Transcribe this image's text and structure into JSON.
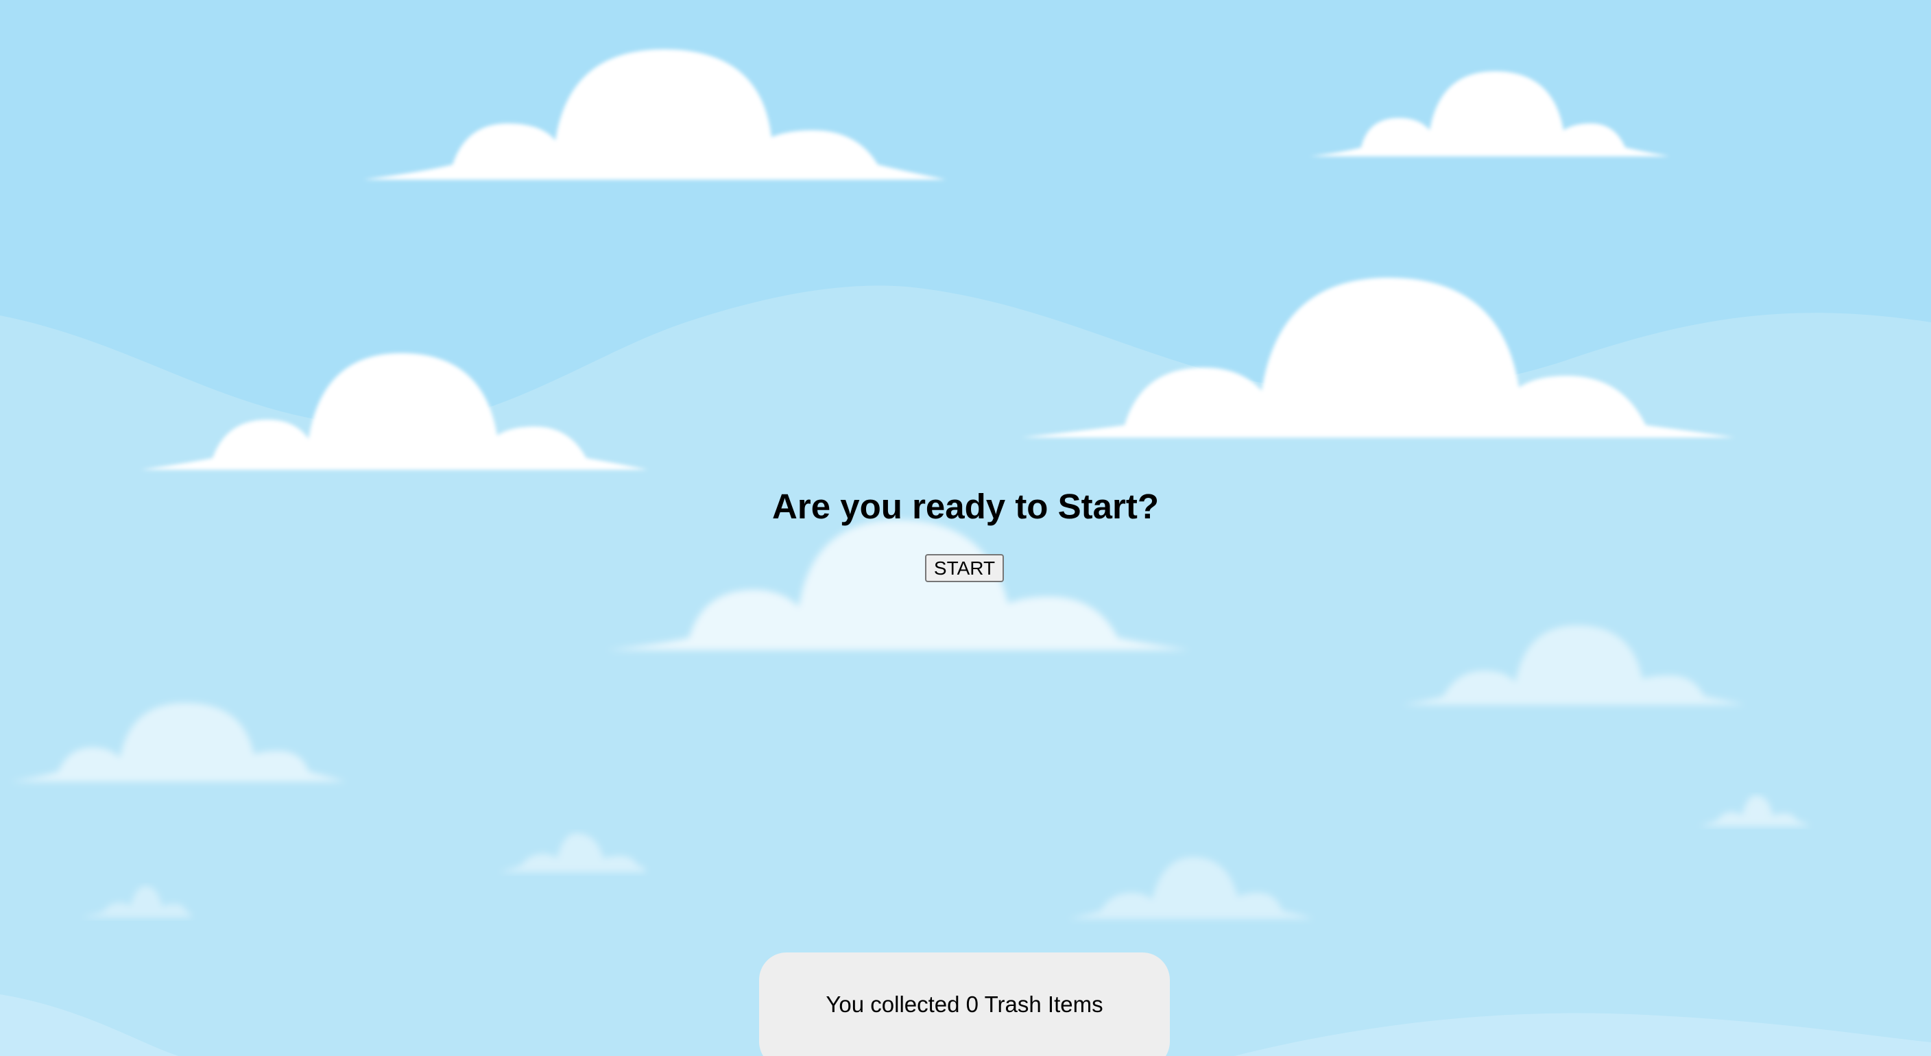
{
  "prompt": {
    "title": "Are you ready to Start?",
    "start_label": "START"
  },
  "score": {
    "text": "You collected 0 Trash Items",
    "count": 0
  },
  "colors": {
    "sky_top": "#a8dff8",
    "sky_hills": "#b8e5f8",
    "cloud": "#ffffff",
    "panel": "#eeeeee",
    "button": "#efefef"
  },
  "icons": {
    "cloud": "cloud-icon"
  }
}
